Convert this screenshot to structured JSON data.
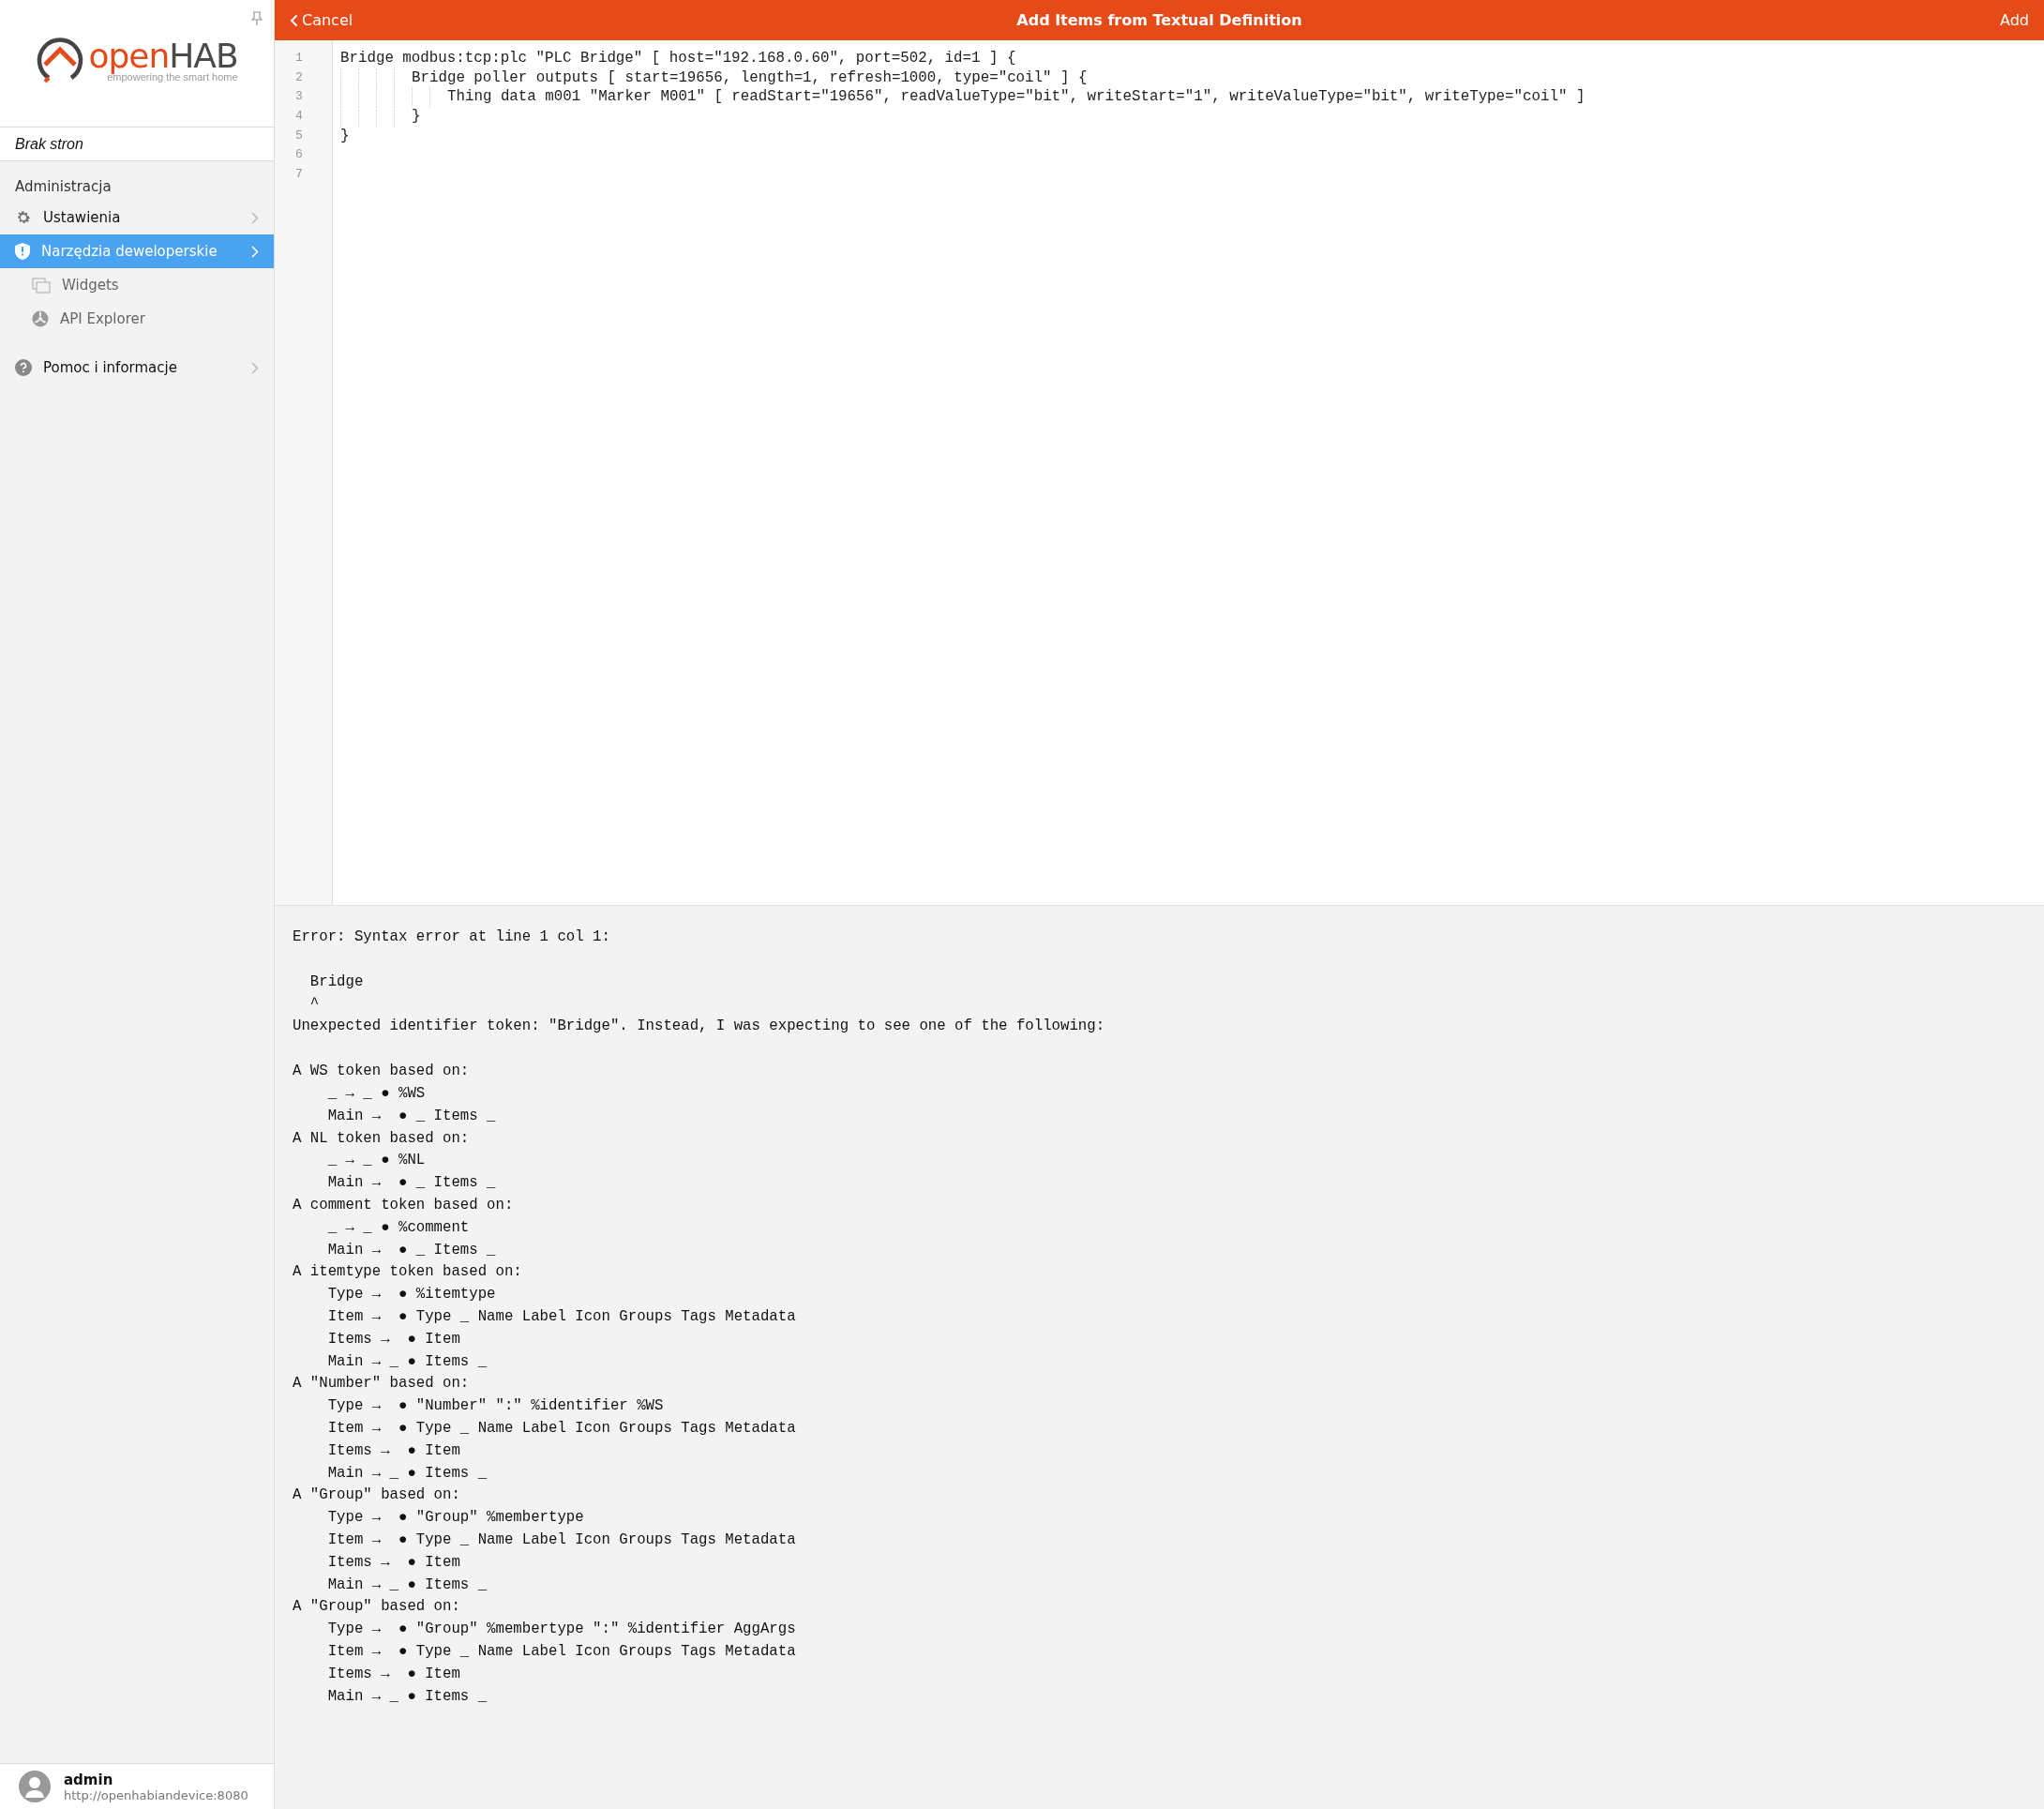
{
  "sidebar": {
    "logo": {
      "name_start": "open",
      "name_end": "HAB",
      "tagline": "empowering the smart home"
    },
    "pages_note": "Brak stron",
    "section_title": "Administracja",
    "items": [
      {
        "kind": "settings",
        "label": "Ustawienia",
        "selected": false
      },
      {
        "kind": "tools",
        "label": "Narzędzia deweloperskie",
        "selected": true,
        "children": [
          {
            "kind": "widgets",
            "label": "Widgets",
            "selected": false
          },
          {
            "kind": "api",
            "label": "API Explorer",
            "selected": false
          }
        ]
      }
    ],
    "help_item": {
      "kind": "help",
      "label": "Pomoc i informacje",
      "selected": false
    },
    "user": {
      "name": "admin",
      "address": "http://openhabiandevice:8080"
    }
  },
  "header": {
    "back": "Cancel",
    "title": "Add Items from Textual Definition",
    "action": "Add"
  },
  "editor": {
    "lines": [
      {
        "number": "1",
        "text": "Bridge modbus:tcp:plc \"PLC Bridge\" [ host=\"192.168.0.60\", port=502, id=1 ] {",
        "children": [
          {
            "number": "2",
            "text": "Bridge poller outputs [ start=19656, length=1, refresh=1000, type=\"coil\" ] {",
            "children": [
              {
                "number": "3",
                "text": "Thing data m001 \"Marker M001\" [ readStart=\"19656\", readValueType=\"bit\", writeStart=\"1\", writeValueType=\"bit\", writeType=\"coil\" ]"
              }
            ]
          },
          {
            "number": "4",
            "text": "}"
          }
        ]
      },
      {
        "number": "5",
        "text": "}"
      },
      {
        "number": "6"
      },
      {
        "number": "7"
      }
    ]
  },
  "error": {
    "blocks": [
      [
        "Error: Syntax error at line 1 col 1:"
      ],
      [
        "  Bridge",
        "  ^",
        "Unexpected identifier token: \"Bridge\". Instead, I was expecting to see one of the following:"
      ],
      [
        "A WS token based on:",
        "    _ → _ ● %WS",
        "    Main →  ● _ Items _",
        "A NL token based on:",
        "    _ → _ ● %NL",
        "    Main →  ● _ Items _",
        "A comment token based on:",
        "    _ → _ ● %comment",
        "    Main →  ● _ Items _",
        "A itemtype token based on:",
        "    Type →  ● %itemtype",
        "    Item →  ● Type _ Name Label Icon Groups Tags Metadata",
        "    Items →  ● Item",
        "    Main → _ ● Items _",
        "A \"Number\" based on:",
        "    Type →  ● \"Number\" \":\" %identifier %WS",
        "    Item →  ● Type _ Name Label Icon Groups Tags Metadata",
        "    Items →  ● Item",
        "    Main → _ ● Items _",
        "A \"Group\" based on:",
        "    Type →  ● \"Group\" %membertype",
        "    Item →  ● Type _ Name Label Icon Groups Tags Metadata",
        "    Items →  ● Item",
        "    Main → _ ● Items _",
        "A \"Group\" based on:",
        "    Type →  ● \"Group\" %membertype \":\" %identifier AggArgs",
        "    Item →  ● Type _ Name Label Icon Groups Tags Metadata",
        "    Items →  ● Item",
        "    Main → _ ● Items _"
      ]
    ]
  }
}
